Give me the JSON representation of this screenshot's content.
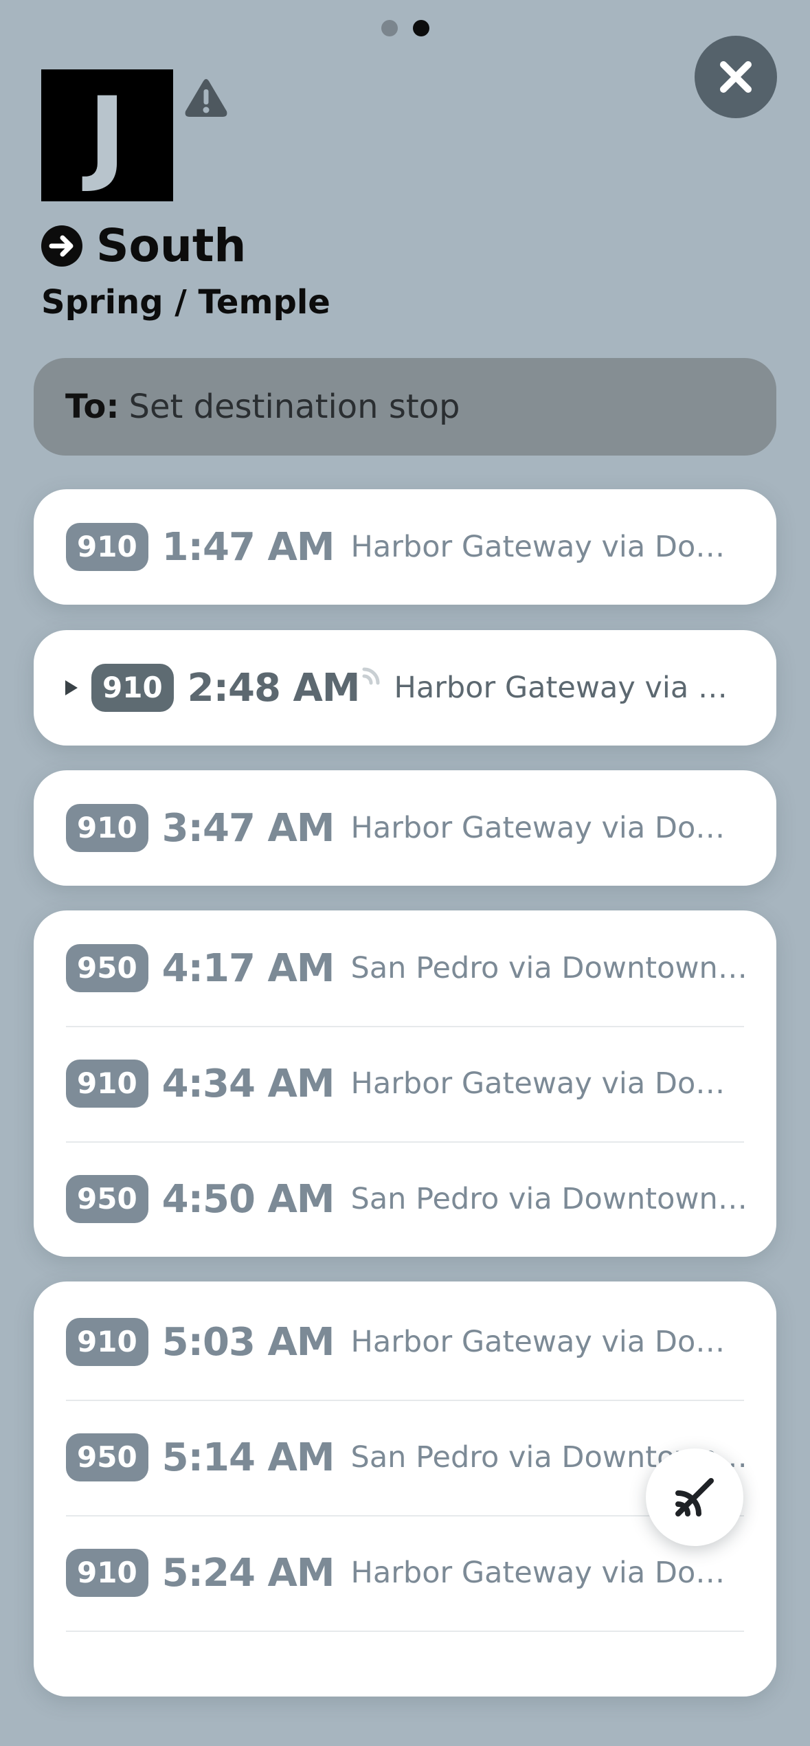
{
  "pager": {
    "dots": 2,
    "active_index": 1
  },
  "header": {
    "line_letter": "J",
    "direction": "South",
    "stop": "Spring / Temple"
  },
  "destination": {
    "prefix": "To:",
    "placeholder": "Set destination stop"
  },
  "colors": {
    "background": "#a7b5bf",
    "badge": "#7e8c98",
    "badge_live": "#5e6b72",
    "logo_bg": "#000000"
  },
  "departures": [
    {
      "route": "910",
      "time": "1:47 AM",
      "destination": "Harbor Gateway via Downtown..."
    },
    {
      "route": "910",
      "time": "2:48 AM",
      "destination": "Harbor Gateway via Down...",
      "live": true
    },
    {
      "route": "910",
      "time": "3:47 AM",
      "destination": "Harbor Gateway via Downtow..."
    },
    {
      "route": "950",
      "time": "4:17 AM",
      "destination": "San Pedro via Downtown LA"
    },
    {
      "route": "910",
      "time": "4:34 AM",
      "destination": "Harbor Gateway via Downtow..."
    },
    {
      "route": "950",
      "time": "4:50 AM",
      "destination": "San Pedro via Downtown LA"
    },
    {
      "route": "910",
      "time": "5:03 AM",
      "destination": "Harbor Gateway via Downtow..."
    },
    {
      "route": "950",
      "time": "5:14 AM",
      "destination": "San Pedro via Downtown LA"
    },
    {
      "route": "910",
      "time": "5:24 AM",
      "destination": "Harbor Gateway via Downtow..."
    }
  ],
  "icons": {
    "close": "close-icon",
    "alert": "alert-icon",
    "direction": "arrow-right-circle-icon",
    "expand": "triangle-right-icon",
    "realtime": "realtime-signal-icon",
    "fab": "no-realtime-icon"
  }
}
